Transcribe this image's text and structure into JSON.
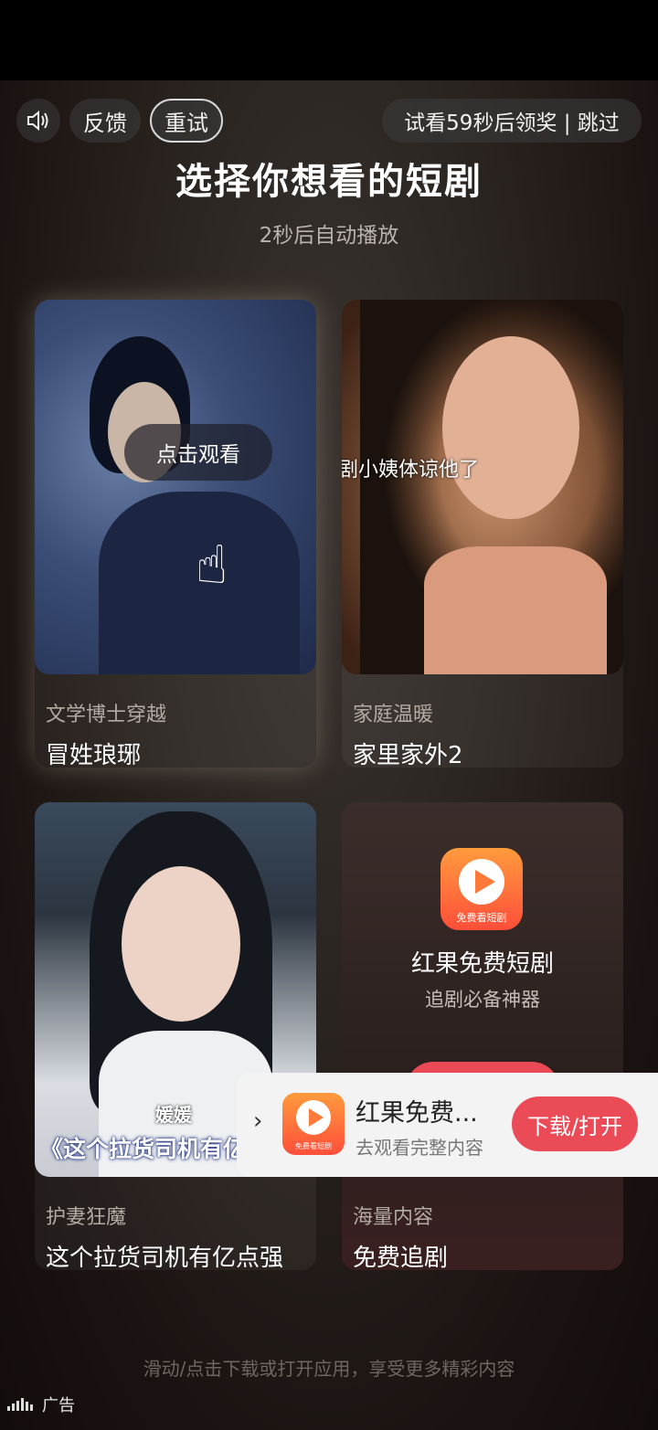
{
  "topbar": {
    "feedback_label": "反馈",
    "retry_label": "重试",
    "skip_label": "试看59秒后领奖 | 跳过"
  },
  "header": {
    "title": "选择你想看的短剧",
    "subtitle": "2秒后自动播放"
  },
  "cards": [
    {
      "tag": "文学博士穿越",
      "name": "冒姓琅琊",
      "hint": "点击观看"
    },
    {
      "tag": "家庭温暖",
      "name": "家里家外2",
      "caption": "剧小姨体谅他了"
    },
    {
      "tag": "护妻狂魔",
      "name": "这个拉货司机有亿点强",
      "caption_small": "媛媛",
      "caption_large": "《这个拉货司机有亿"
    },
    {
      "tag": "海量内容",
      "name": "免费追剧",
      "app_title": "红果免费短剧",
      "app_desc": "追剧必备神器",
      "icon_label": "免费看短剧"
    }
  ],
  "footer": {
    "hint": "滑动/点击下载或打开应用，享受更多精彩内容",
    "ad_label": "广告"
  },
  "banner": {
    "title": "红果免费...",
    "desc": "去观看完整内容",
    "button_label": "下载/打开",
    "icon_label": "免费看短剧"
  },
  "colors": {
    "accent": "#ea4b57",
    "app_icon": "#ff6a3a"
  }
}
